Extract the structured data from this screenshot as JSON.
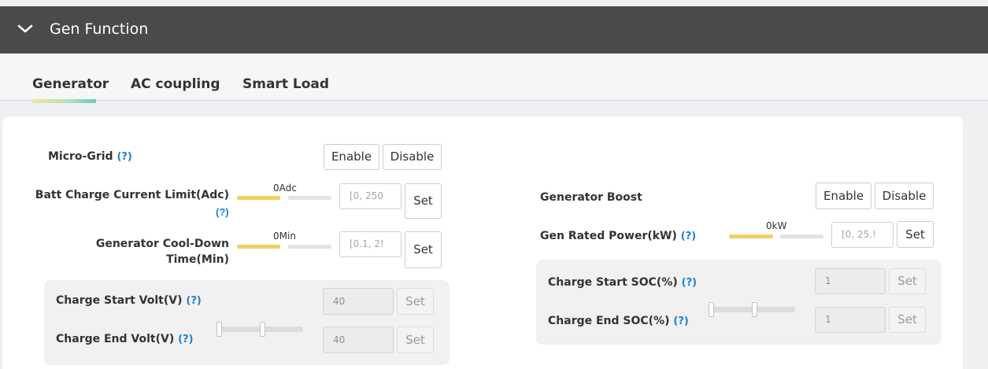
{
  "header": {
    "title": "Gen Function",
    "icon": "chevron-down-icon"
  },
  "tabs": [
    {
      "label": "Generator",
      "active": true
    },
    {
      "label": "AC coupling",
      "active": false
    },
    {
      "label": "Smart Load",
      "active": false
    }
  ],
  "help_mark": "(?)",
  "left": {
    "micro_grid": {
      "label": "Micro-Grid",
      "enable": "Enable",
      "disable": "Disable"
    },
    "batt_charge": {
      "label": "Batt Charge Current Limit(Adc)",
      "value": "0Adc",
      "placeholder": "[0, 250",
      "set": "Set",
      "level": 0
    },
    "cool_down": {
      "label_line1": "Generator Cool-Down",
      "label_line2": "Time(Min)",
      "value": "0Min",
      "placeholder": "[0.1, 2!",
      "set": "Set",
      "level": 0
    },
    "charge_start_volt": {
      "label": "Charge Start Volt(V)",
      "value": "40",
      "set": "Set"
    },
    "charge_end_volt": {
      "label": "Charge End Volt(V)",
      "value": "40",
      "set": "Set"
    }
  },
  "right": {
    "gen_boost": {
      "label": "Generator Boost",
      "enable": "Enable",
      "disable": "Disable"
    },
    "gen_rated_power": {
      "label": "Gen Rated Power(kW)",
      "value": "0kW",
      "placeholder": "[0, 25.!",
      "set": "Set",
      "level": 0
    },
    "charge_start_soc": {
      "label": "Charge Start SOC(%)",
      "value": "1",
      "set": "Set"
    },
    "charge_end_soc": {
      "label": "Charge End SOC(%)",
      "value": "1",
      "set": "Set"
    }
  },
  "colors": {
    "accent_fill": "#ecd25f",
    "help_blue": "#1a7fd4",
    "header_bg": "#4a4a4a"
  }
}
